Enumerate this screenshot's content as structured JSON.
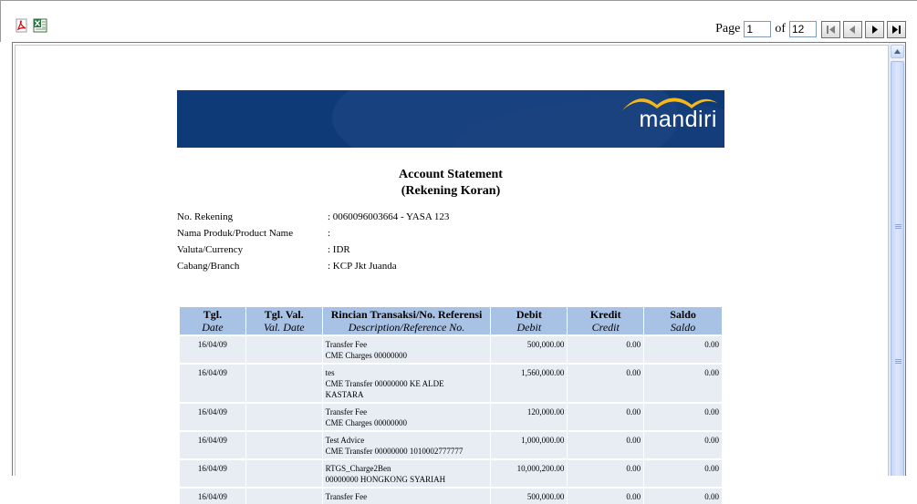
{
  "toolbar": {
    "pdf_icon": "pdf-export-icon",
    "excel_icon": "excel-export-icon",
    "page_label": "Page",
    "page_value": "1",
    "of_label": "of",
    "total_pages": "12"
  },
  "statement": {
    "brand": "mandiri",
    "title_line1": "Account Statement",
    "title_line2": "(Rekening Koran)",
    "info": [
      {
        "label": "No. Rekening",
        "value": ": 0060096003664 - YASA 123"
      },
      {
        "label": "Nama Produk/Product Name",
        "value": ":"
      },
      {
        "label": "Valuta/Currency",
        "value": ": IDR"
      },
      {
        "label": "Cabang/Branch",
        "value": ": KCP Jkt Juanda"
      }
    ],
    "columns": [
      {
        "id": "Tgl.",
        "en": "Date"
      },
      {
        "id": "Tgl. Val.",
        "en": "Val. Date"
      },
      {
        "id": "Rincian Transaksi/No. Referensi",
        "en": "Description/Reference No."
      },
      {
        "id": "Debit",
        "en": "Debit"
      },
      {
        "id": "Kredit",
        "en": "Credit"
      },
      {
        "id": "Saldo",
        "en": "Saldo"
      }
    ],
    "rows": [
      {
        "date": "16/04/09",
        "val_date": "",
        "desc1": "Transfer Fee",
        "desc2": "CME Charges 00000000",
        "desc3": "",
        "debit": "500,000.00",
        "credit": "0.00",
        "saldo": "0.00"
      },
      {
        "date": "16/04/09",
        "val_date": "",
        "desc1": "tes",
        "desc2": "CME Transfer 00000000 KE ALDE",
        "desc3": "KASTARA",
        "debit": "1,560,000.00",
        "credit": "0.00",
        "saldo": "0.00"
      },
      {
        "date": "16/04/09",
        "val_date": "",
        "desc1": "Transfer Fee",
        "desc2": "CME Charges 00000000",
        "desc3": "",
        "debit": "120,000.00",
        "credit": "0.00",
        "saldo": "0.00"
      },
      {
        "date": "16/04/09",
        "val_date": "",
        "desc1": "Test Advice",
        "desc2": "CME Transfer 00000000 1010002777777",
        "desc3": "",
        "debit": "1,000,000.00",
        "credit": "0.00",
        "saldo": "0.00"
      },
      {
        "date": "16/04/09",
        "val_date": "",
        "desc1": "RTGS_Charge2Ben",
        "desc2": "00000000 HONGKONG SYARIAH",
        "desc3": "",
        "debit": "10,000,200.00",
        "credit": "0.00",
        "saldo": "0.00"
      },
      {
        "date": "16/04/09",
        "val_date": "",
        "desc1": "Transfer Fee",
        "desc2": "",
        "desc3": "",
        "debit": "500,000.00",
        "credit": "0.00",
        "saldo": "0.00"
      }
    ]
  }
}
